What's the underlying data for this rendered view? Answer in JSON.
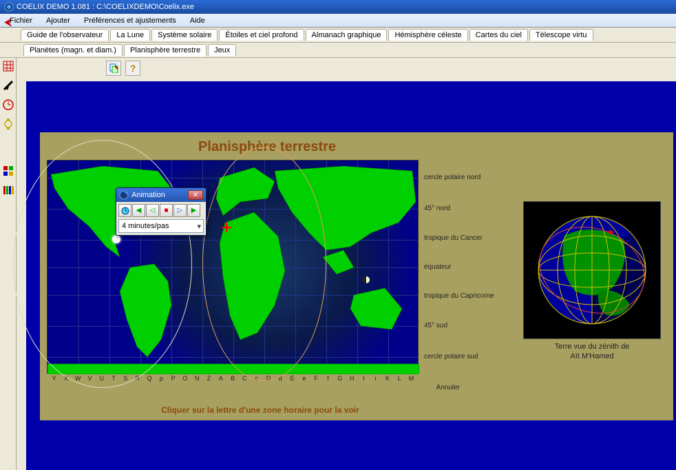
{
  "window": {
    "title": "COELIX DEMO 1.081 : C:\\COELIXDEMO\\Coelix.exe"
  },
  "menu": {
    "file": "Fichier",
    "add": "Ajouter",
    "prefs": "Préférences et ajustements",
    "help": "Aide"
  },
  "tabs_row1": {
    "guide": "Guide de l'observateur",
    "lune": "La Lune",
    "solar": "Système solaire",
    "stars": "Étoiles et ciel profond",
    "almanac": "Almanach graphique",
    "hemis": "Hémisphère céleste",
    "cards": "Cartes du ciel",
    "telescope": "Télescope virtu"
  },
  "tabs_row2": {
    "planets": "Planètes (magn. et diam.)",
    "planis": "Planisphère terrestre",
    "games": "Jeux"
  },
  "panel": {
    "title": "Planisphère terrestre",
    "click_msg": "Cliquer sur la lettre d'une zone horaire pour la voir"
  },
  "lat_labels": {
    "arctic": "cercle polaire nord",
    "n45": "45° nord",
    "cancer": "tropique du Cancer",
    "eq": "équateur",
    "capri": "tropique du Capricorne",
    "s45": "45° sud",
    "antarctic": "cercle polaire sud"
  },
  "tz": {
    "letters": [
      "Y",
      "X",
      "W",
      "V",
      "U",
      "T",
      "S",
      "R",
      "Q",
      "p",
      "P",
      "O",
      "N",
      "Z",
      "A",
      "B",
      "C",
      "c",
      "D",
      "d",
      "E",
      "e",
      "F",
      "f",
      "G",
      "H",
      "I",
      "i",
      "K",
      "L",
      "M"
    ],
    "annuler": "Annuler"
  },
  "globe": {
    "caption1": "Terre vue du zénith de",
    "caption2": "Aït M'Hamed"
  },
  "anim": {
    "title": "Animation",
    "step": "4 minutes/pas"
  }
}
